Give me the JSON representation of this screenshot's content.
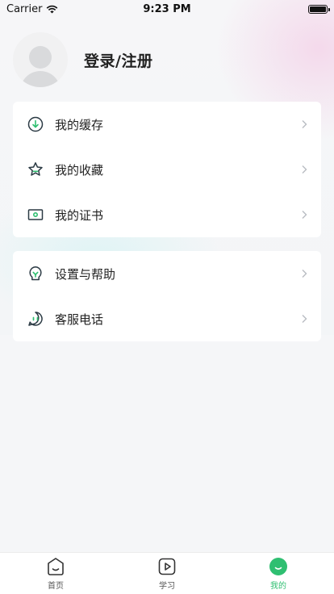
{
  "status_bar": {
    "carrier": "Carrier",
    "time": "9:23 PM"
  },
  "profile": {
    "login_label": "登录/注册"
  },
  "menu_group1": [
    {
      "label": "我的缓存",
      "icon": "download-circle-icon"
    },
    {
      "label": "我的收藏",
      "icon": "star-icon"
    },
    {
      "label": "我的证书",
      "icon": "certificate-icon"
    }
  ],
  "menu_group2": [
    {
      "label": "设置与帮助",
      "icon": "lightbulb-icon"
    },
    {
      "label": "客服电话",
      "icon": "chat-bubble-icon"
    }
  ],
  "tabbar": {
    "tabs": [
      {
        "label": "首页",
        "icon": "home-icon"
      },
      {
        "label": "学习",
        "icon": "play-icon"
      },
      {
        "label": "我的",
        "icon": "profile-smile-icon",
        "active": true
      }
    ]
  },
  "colors": {
    "accent": "#2fbf71",
    "icon_stroke": "#2b3a44"
  }
}
